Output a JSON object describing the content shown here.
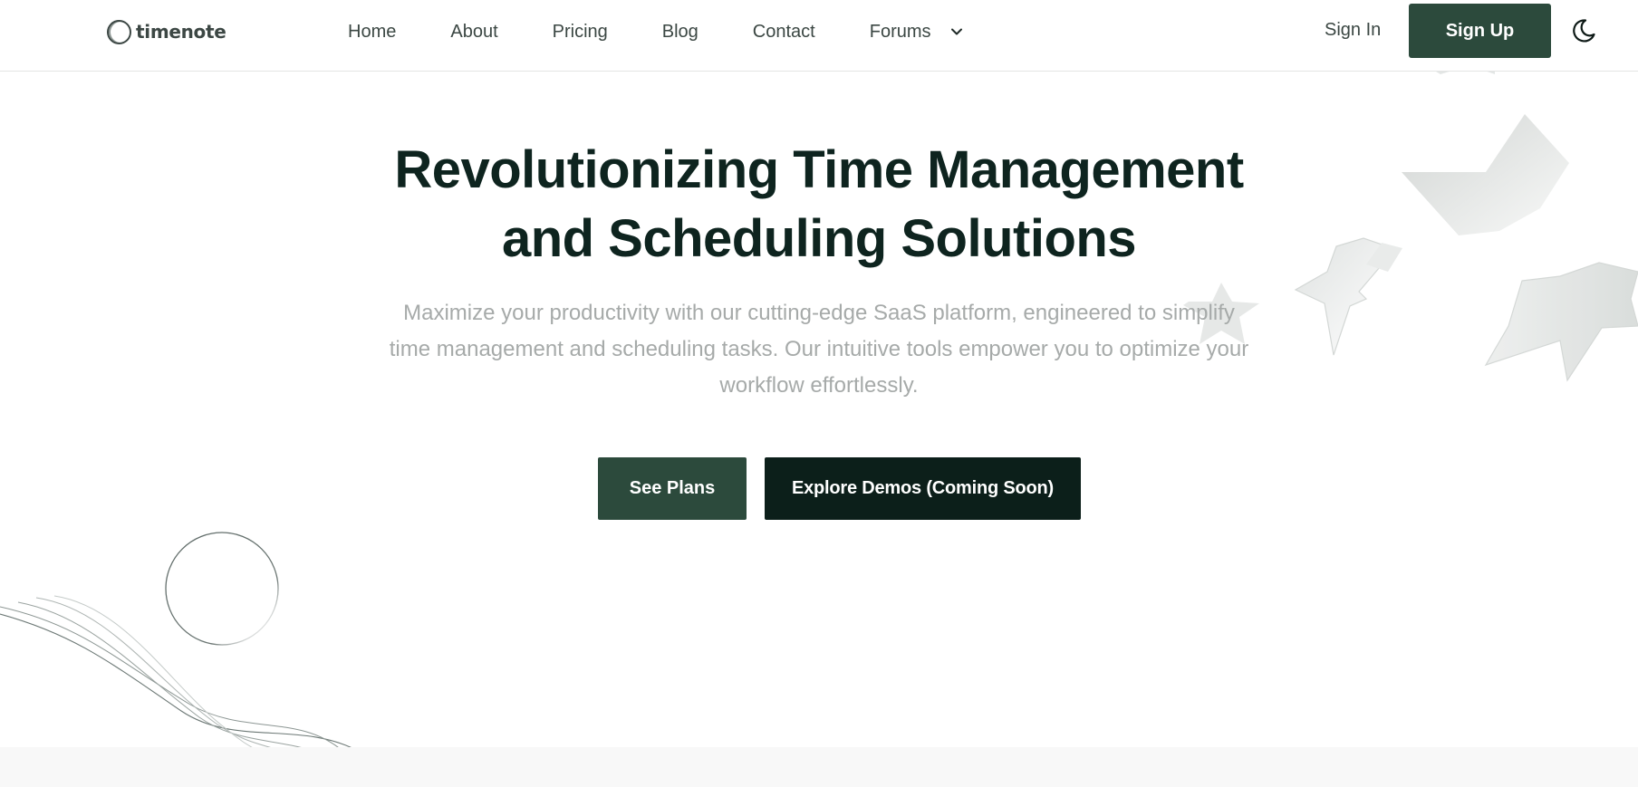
{
  "brand": {
    "name": "timenote",
    "logo_icon": "ring-logo-icon"
  },
  "nav": {
    "items": [
      {
        "label": "Home"
      },
      {
        "label": "About"
      },
      {
        "label": "Pricing"
      },
      {
        "label": "Blog"
      },
      {
        "label": "Contact"
      },
      {
        "label": "Forums",
        "icon": "chevron-down-icon"
      }
    ]
  },
  "auth": {
    "sign_in": "Sign In",
    "sign_up": "Sign Up"
  },
  "theme_toggle": {
    "icon": "moon-icon"
  },
  "hero": {
    "title_line1": "Revolutionizing Time Management",
    "title_line2": "and Scheduling Solutions",
    "subtitle": "Maximize your productivity with our cutting-edge SaaS platform, engineered to simplify time management and scheduling tasks. Our intuitive tools empower you to optimize your workflow effortlessly.",
    "primary_cta": "See Plans",
    "secondary_cta": "Explore Demos (Coming Soon)"
  },
  "colors": {
    "brand_green": "#2c4a3c",
    "dark": "#0c1f1a",
    "muted_text": "#a6aaa9"
  }
}
